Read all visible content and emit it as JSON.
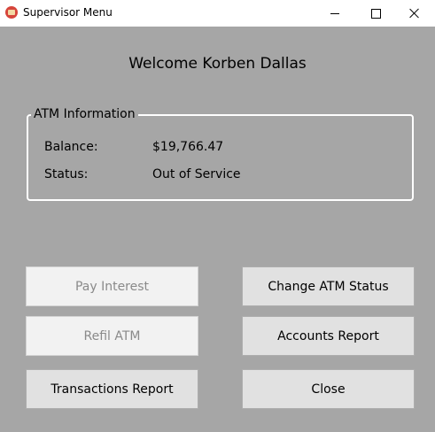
{
  "window": {
    "title": "Supervisor Menu",
    "app_icon": "atm-app-icon",
    "controls": {
      "minimize": "minimize-icon",
      "maximize": "maximize-icon",
      "close": "close-icon"
    }
  },
  "welcome": "Welcome Korben Dallas",
  "atm_info": {
    "legend": "ATM Information",
    "balance_label": "Balance:",
    "balance_value": "$19,766.47",
    "status_label": "Status:",
    "status_value": "Out of Service"
  },
  "buttons": {
    "pay_interest": {
      "label": "Pay Interest",
      "enabled": false
    },
    "change_status": {
      "label": "Change ATM Status",
      "enabled": true
    },
    "refil_atm": {
      "label": "Refil ATM",
      "enabled": false
    },
    "accounts_report": {
      "label": "Accounts Report",
      "enabled": true
    },
    "transactions_report": {
      "label": "Transactions Report",
      "enabled": true
    },
    "close": {
      "label": "Close",
      "enabled": true
    }
  },
  "colors": {
    "client_background": "#a6a6a6",
    "titlebar": "#ffffff",
    "button_face": "#e1e1e1",
    "button_disabled": "#f2f2f2",
    "disabled_text": "#8a8a8a",
    "group_border": "#ffffff"
  }
}
